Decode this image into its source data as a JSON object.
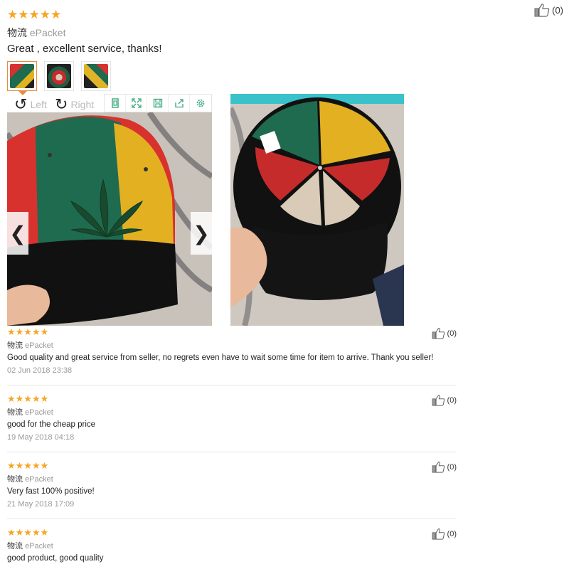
{
  "top_review": {
    "stars": "★★★★★",
    "name": "物流",
    "shipping": "ePacket",
    "text": "Great , excellent service, thanks!",
    "likes": "(0)"
  },
  "viewer": {
    "rotate_left": "Left",
    "rotate_right": "Right",
    "prev_arrow": "❮",
    "next_arrow": "❯"
  },
  "reviews": [
    {
      "stars": "★★★★★",
      "name": "物流",
      "shipping": "ePacket",
      "text": "Good quality and great service from seller, no regrets even have to wait some time for item to arrive. Thank you seller!",
      "date": "02 Jun 2018 23:38",
      "likes": "(0)"
    },
    {
      "stars": "★★★★★",
      "name": "物流",
      "shipping": "ePacket",
      "text": "good for the cheap price",
      "date": "19 May 2018 04:18",
      "likes": "(0)"
    },
    {
      "stars": "★★★★★",
      "name": "物流",
      "shipping": "ePacket",
      "text": "Very fast 100% positive!",
      "date": "21 May 2018 17:09",
      "likes": "(0)"
    },
    {
      "stars": "★★★★★",
      "name": "物流",
      "shipping": "ePacket",
      "text": "good product, good quality",
      "date": "",
      "likes": "(0)"
    }
  ],
  "colors": {
    "star": "#f5a623",
    "active_thumb": "#e98b3b",
    "toolbar_icon": "#3aa57a"
  }
}
